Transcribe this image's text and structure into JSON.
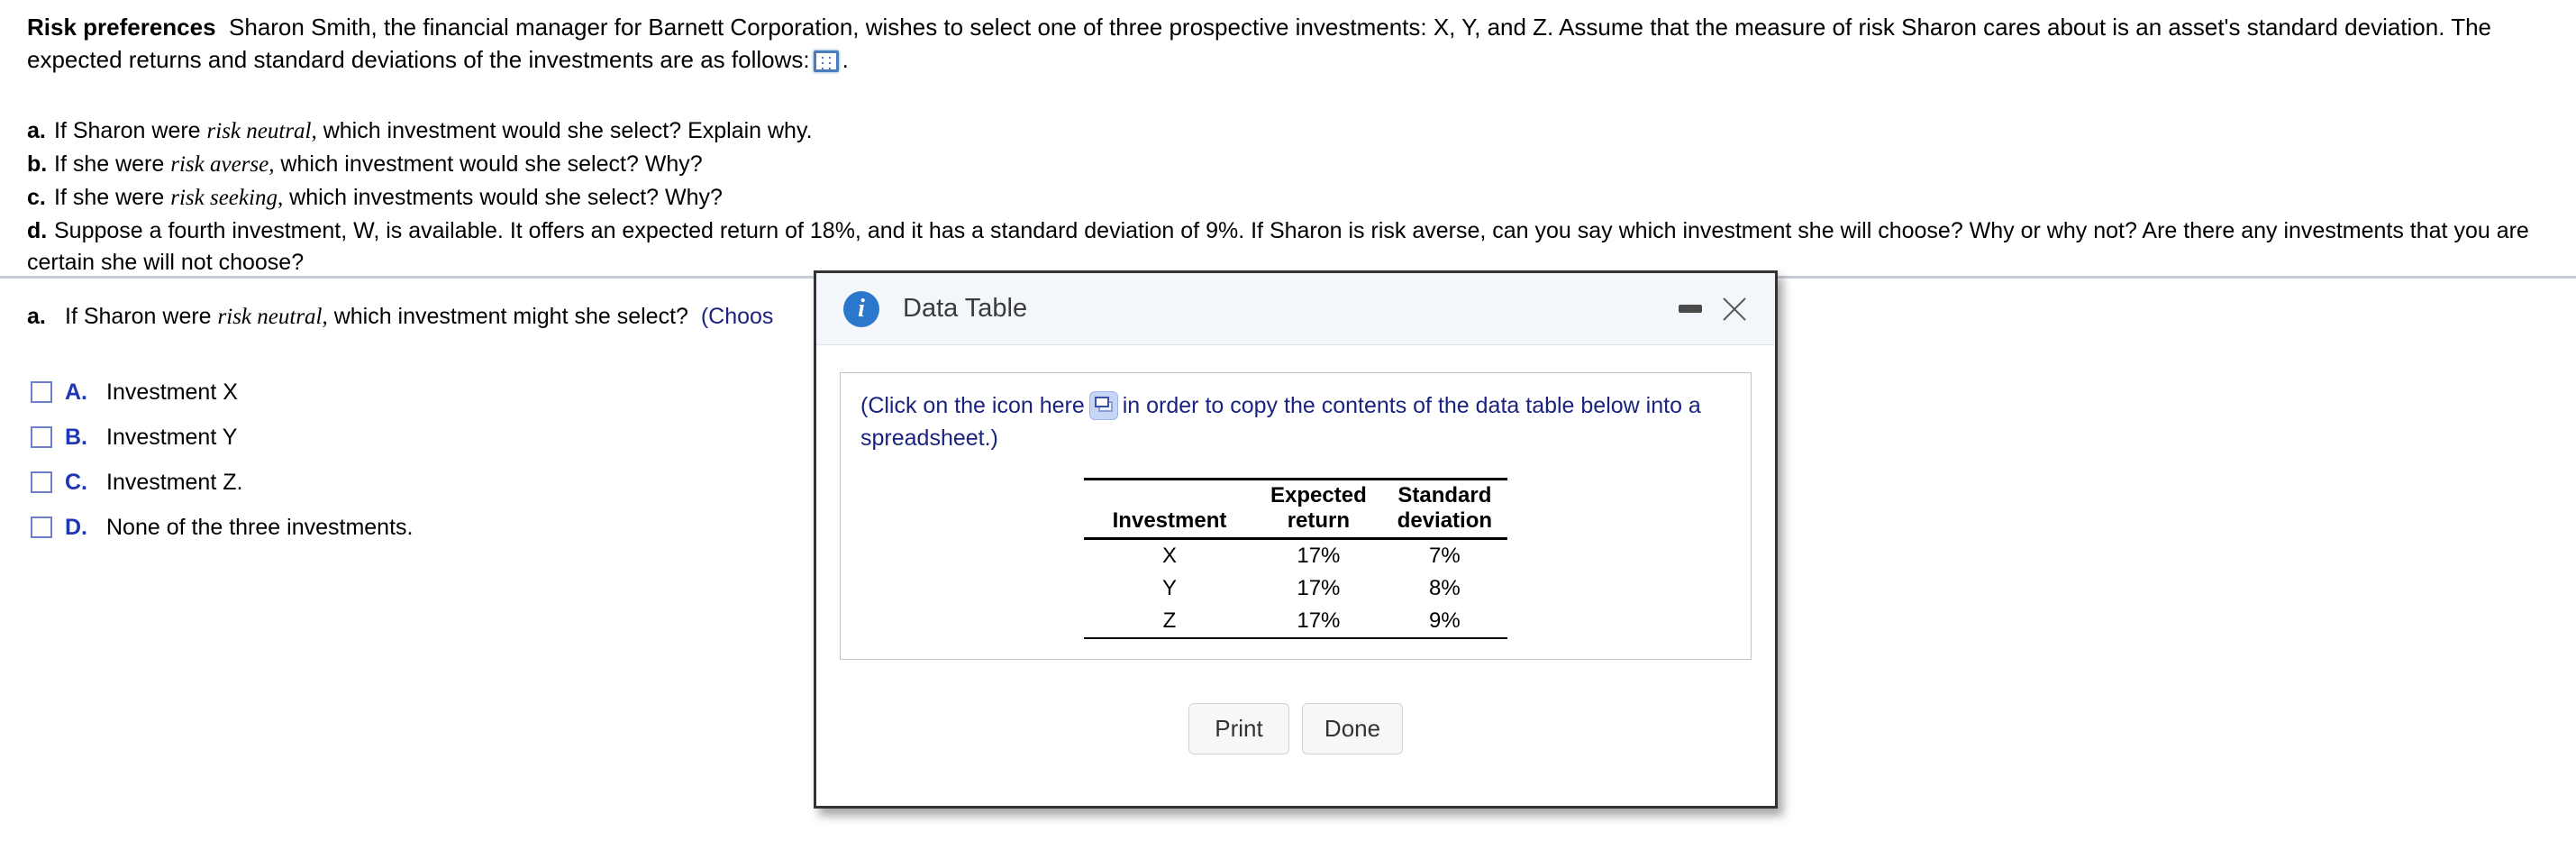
{
  "problem": {
    "title": "Risk preferences",
    "stem_part1": "Sharon Smith, the financial manager for Barnett Corporation, wishes to select one of three prospective investments: X, Y, and Z. Assume that the measure of risk Sharon cares about is an asset's standard deviation. The expected returns and standard deviations of the investments are as follows:",
    "stem_part2": ".",
    "grid_icon_name": "spreadsheet-icon",
    "parts": [
      {
        "letter": "a.",
        "text_before": "If Sharon were ",
        "emphasis": "risk neutral,",
        "text_after": " which investment would she select?  Explain why."
      },
      {
        "letter": "b.",
        "text_before": "If she were ",
        "emphasis": "risk averse,",
        "text_after": " which investment would she select? Why?"
      },
      {
        "letter": "c.",
        "text_before": "If she were ",
        "emphasis": "risk seeking,",
        "text_after": " which investments would she select?  Why?"
      },
      {
        "letter": "d.",
        "text_before": "Suppose a fourth investment, W, is available. It offers an expected return of 18%, and it has a standard deviation of 9%. If Sharon is risk averse, can you say which investment she will choose? Why or why not? Are there any investments that you are certain she will not choose?",
        "emphasis": "",
        "text_after": ""
      }
    ]
  },
  "sub_question": {
    "letter": "a.",
    "text_before": "If Sharon were ",
    "emphasis": "risk neutral,",
    "text_after": " which investment might she select?",
    "hint": "(Choos",
    "choices": [
      {
        "letter": "A.",
        "text": "Investment X"
      },
      {
        "letter": "B.",
        "text": "Investment Y"
      },
      {
        "letter": "C.",
        "text": "Investment Z."
      },
      {
        "letter": "D.",
        "text": "None of the three investments."
      }
    ]
  },
  "dialog": {
    "title": "Data Table",
    "info_icon_glyph": "i",
    "minimize_label": "",
    "close_label": "",
    "instruction_before": "(Click on the icon here",
    "instruction_after": "in order to copy the contents of the data table below into a spreadsheet.)",
    "buttons": {
      "print": "Print",
      "done": "Done"
    }
  },
  "chart_data": {
    "type": "table",
    "title": "Data Table",
    "columns": [
      "Investment",
      "Expected return",
      "Standard deviation"
    ],
    "column_lines": [
      [
        "Investment"
      ],
      [
        "Expected",
        "return"
      ],
      [
        "Standard",
        "deviation"
      ]
    ],
    "rows": [
      {
        "investment": "X",
        "expected_return": "17%",
        "standard_deviation": "7%"
      },
      {
        "investment": "Y",
        "expected_return": "17%",
        "standard_deviation": "8%"
      },
      {
        "investment": "Z",
        "expected_return": "17%",
        "standard_deviation": "9%"
      }
    ]
  },
  "colors": {
    "link_blue": "#1a237e",
    "choice_blue": "#1f36b5",
    "info_blue": "#2b77cc",
    "header_bg": "#f3f7fb"
  }
}
